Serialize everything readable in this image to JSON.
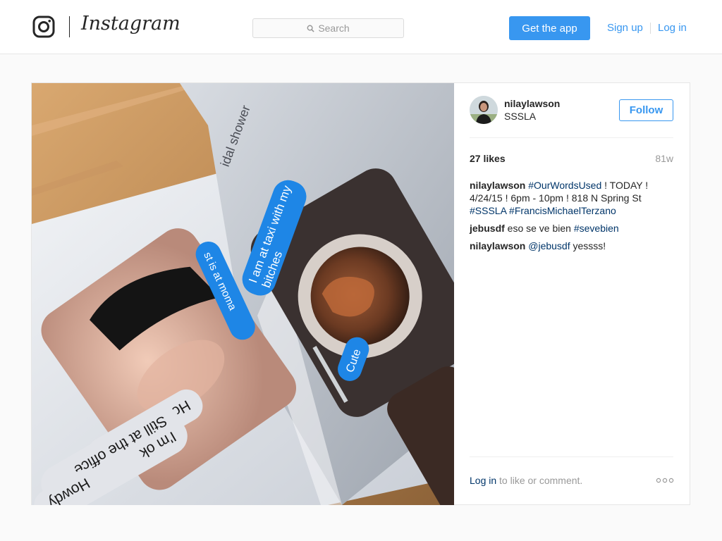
{
  "header": {
    "brand": "Instagram",
    "search_placeholder": "Search",
    "get_app_label": "Get the app",
    "signup_label": "Sign up",
    "login_label": "Log in"
  },
  "post": {
    "username": "nilaylawson",
    "location": "SSSLA",
    "follow_label": "Follow",
    "likes": "27 likes",
    "age": "81w",
    "comments": [
      {
        "user": "nilaylawson",
        "parts": [
          {
            "tag": "#OurWordsUsed"
          },
          {
            "text": " ! TODAY ! 4/24/15 ! 6pm - 10pm ! 818 N Spring St "
          },
          {
            "tag": "#SSSLA"
          },
          {
            "text": " "
          },
          {
            "tag": "#FrancisMichaelTerzano"
          }
        ]
      },
      {
        "user": "jebusdf",
        "parts": [
          {
            "text": "eso se ve bien "
          },
          {
            "tag": "#sevebien"
          }
        ]
      },
      {
        "user": "nilaylawson",
        "parts": [
          {
            "tag": "@jebusdf"
          },
          {
            "text": " yessss!"
          }
        ]
      }
    ],
    "login_prompt": {
      "link": "Log in",
      "rest": " to like or comment."
    },
    "photo_text": {
      "bubble_howdy": "Howdy",
      "bubble_ok": "I'm ok",
      "bubble_office": "Still at the office",
      "bubble_lacma": "How's LACMA?",
      "bubble_taxi": "I am at taxi with my",
      "bubble_bitches": "bitches",
      "bubble_shower": "idal shower",
      "bubble_moma": "st is at moma",
      "bubble_cute": "Cute"
    }
  },
  "colors": {
    "accent": "#3897f0",
    "hashtag": "#003569",
    "muted": "#999999"
  }
}
